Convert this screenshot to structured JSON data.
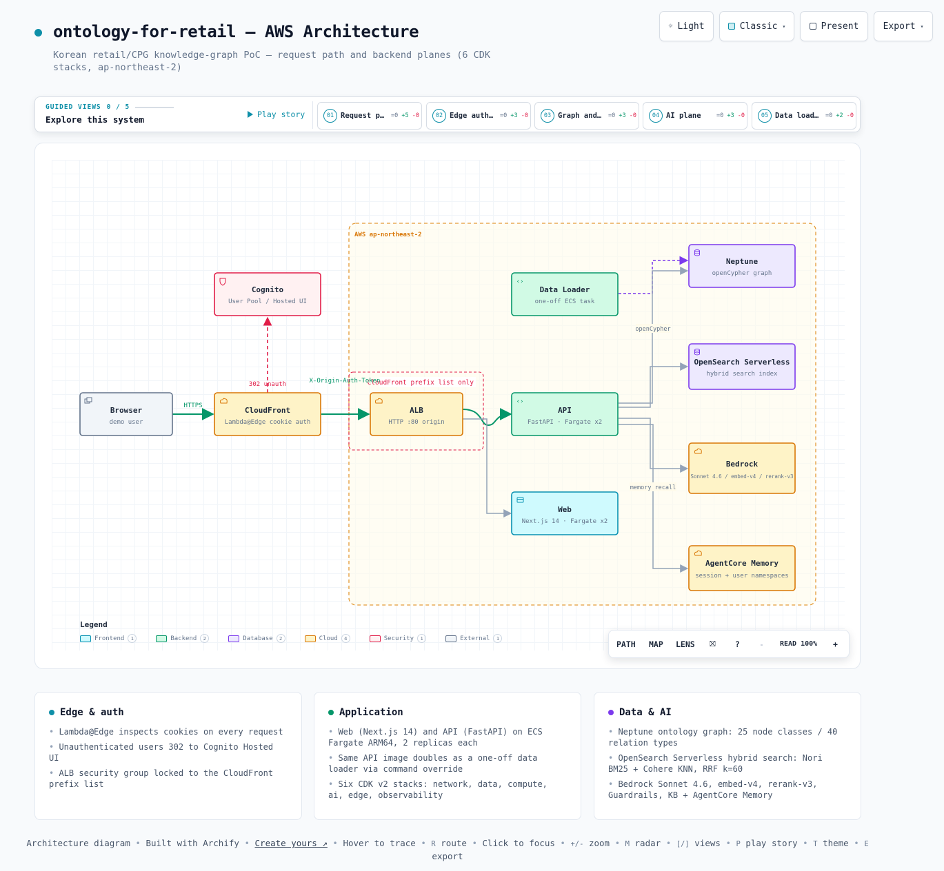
{
  "header": {
    "title": "ontology-for-retail — AWS Architecture",
    "subtitle": "Korean retail/CPG knowledge-graph PoC — request path and backend planes (6 CDK stacks, ap-northeast-2)"
  },
  "toolbar": {
    "theme_label": "Light",
    "style_label": "Classic",
    "present_label": "Present",
    "export_label": "Export"
  },
  "guided": {
    "eyebrow": "GUIDED VIEWS",
    "progress": "0 / 5",
    "explore": "Explore this system",
    "play": "Play story",
    "views": [
      {
        "num": "01",
        "label": "Request path",
        "same": "=0",
        "plus": "+5",
        "minus": "-0"
      },
      {
        "num": "02",
        "label": "Edge authentication",
        "same": "=0",
        "plus": "+3",
        "minus": "-0"
      },
      {
        "num": "03",
        "label": "Graph and search",
        "same": "=0",
        "plus": "+3",
        "minus": "-0"
      },
      {
        "num": "04",
        "label": "AI plane",
        "same": "=0",
        "plus": "+3",
        "minus": "-0"
      },
      {
        "num": "05",
        "label": "Data loading",
        "same": "=0",
        "plus": "+2",
        "minus": "-0"
      }
    ]
  },
  "colors": {
    "accent": "#0e8fa8",
    "frontend": "#0891b2",
    "backend": "#059669",
    "database": "#7c3aed",
    "cloud": "#d97706",
    "security": "#e11d48",
    "external": "#64748b"
  },
  "diagram": {
    "region_label": "AWS ap-northeast-2",
    "sg_label": "CloudFront prefix list only",
    "nodes": {
      "browser": {
        "title": "Browser",
        "sub": "demo user",
        "icon": "window-icon"
      },
      "cognito": {
        "title": "Cognito",
        "sub": "User Pool / Hosted UI",
        "icon": "shield-icon"
      },
      "cloudfront": {
        "title": "CloudFront",
        "sub": "Lambda@Edge cookie auth",
        "icon": "cloud-icon"
      },
      "alb": {
        "title": "ALB",
        "sub": "HTTP :80 origin",
        "icon": "cloud-icon"
      },
      "loader": {
        "title": "Data Loader",
        "sub": "one-off ECS task",
        "icon": "code-icon"
      },
      "api": {
        "title": "API",
        "sub": "FastAPI · Fargate x2",
        "icon": "code-icon"
      },
      "web": {
        "title": "Web",
        "sub": "Next.js 14 · Fargate x2",
        "icon": "browser-icon"
      },
      "neptune": {
        "title": "Neptune",
        "sub": "openCypher graph",
        "icon": "database-icon"
      },
      "opensearch": {
        "title": "OpenSearch Serverless",
        "sub": "hybrid search index",
        "icon": "database-icon"
      },
      "bedrock": {
        "title": "Bedrock",
        "sub": "Sonnet 4.6 / embed-v4 / rerank-v3",
        "icon": "cloud-icon"
      },
      "memory": {
        "title": "AgentCore Memory",
        "sub": "session + user namespaces",
        "icon": "cloud-icon"
      }
    },
    "edges": {
      "https": "HTTPS",
      "unauth": "302 unauth",
      "origin_token": "X-Origin-Auth-Token",
      "opencypher": "openCypher",
      "memory_recall": "memory recall"
    }
  },
  "legend": {
    "title": "Legend",
    "items": [
      {
        "label": "Frontend",
        "count": "1"
      },
      {
        "label": "Backend",
        "count": "2"
      },
      {
        "label": "Database",
        "count": "2"
      },
      {
        "label": "Cloud",
        "count": "4"
      },
      {
        "label": "Security",
        "count": "1"
      },
      {
        "label": "External",
        "count": "1"
      }
    ]
  },
  "controls": {
    "path": "PATH",
    "map": "MAP",
    "lens": "LENS",
    "help": "?",
    "minus": "-",
    "zoom": "READ 100%",
    "plus": "+"
  },
  "cards": [
    {
      "title": "Edge & auth",
      "items": [
        "Lambda@Edge inspects cookies on every request",
        "Unauthenticated users 302 to Cognito Hosted UI",
        "ALB security group locked to the CloudFront prefix list"
      ]
    },
    {
      "title": "Application",
      "items": [
        "Web (Next.js 14) and API (FastAPI) on ECS Fargate ARM64, 2 replicas each",
        "Same API image doubles as a one-off data loader via command override",
        "Six CDK v2 stacks: network, data, compute, ai, edge, observability"
      ]
    },
    {
      "title": "Data & AI",
      "items": [
        "Neptune ontology graph: 25 node classes / 40 relation types",
        "OpenSearch Serverless hybrid search: Nori BM25 + Cohere KNN, RRF k=60",
        "Bedrock Sonnet 4.6, embed-v4, rerank-v3, Guardrails, KB + AgentCore Memory"
      ]
    }
  ],
  "footer": {
    "t1": "Architecture diagram",
    "t2": "Built with Archify",
    "link": "Create yours ↗",
    "t3": "Hover to trace",
    "k_r": "R",
    "t4": "route",
    "t5": "Click to focus",
    "k_zoom": "+/-",
    "t6": "zoom",
    "k_m": "M",
    "t7": "radar",
    "k_views": "[/]",
    "t8": "views",
    "k_p": "P",
    "t9": "play story",
    "k_t": "T",
    "t10": "theme",
    "k_e": "E",
    "t11": "export"
  }
}
